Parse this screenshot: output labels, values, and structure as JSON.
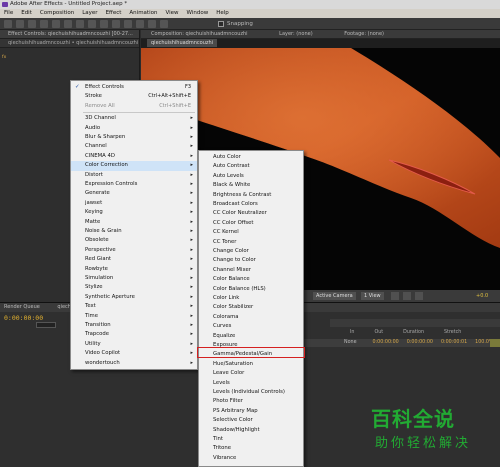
{
  "window": {
    "title": "Adobe After Effects - Untitled Project.aep *"
  },
  "menubar": [
    "File",
    "Edit",
    "Composition",
    "Layer",
    "Effect",
    "Animation",
    "View",
    "Window",
    "Help"
  ],
  "toolbar": {
    "snapping_label": "Snapping"
  },
  "left_panel": {
    "tab": "Effect Controls: qiechuishihuadmncouzhi [00-27...",
    "path": "qiechuishihuadmncouzhi • qiechuishihuadmncouzhi [00-271].png",
    "effect_item": "fx"
  },
  "composition": {
    "header_composition": "Composition: qiechuishihuadmncouzhi",
    "header_layer": "Layer: (none)",
    "header_footage": "Footage: (none)",
    "tab": "qiechuishihuadmncouzhi"
  },
  "viewer_controls": {
    "camera": "Active Camera",
    "view": "1 View",
    "value": "+0.0"
  },
  "timeline": {
    "tabs": [
      "Render Queue",
      "qiechuishi..."
    ],
    "timecode": "0:00:00:00",
    "columns": [
      "In",
      "Out",
      "Duration",
      "Stretch"
    ],
    "row": {
      "parent": "None",
      "in": "0:00:00:00",
      "out": "0:00:00:00",
      "duration": "0:00:00:01",
      "stretch": "100.0%"
    }
  },
  "context_menu": {
    "items": [
      {
        "label": "Effect Controls",
        "shortcut": "F3",
        "checked": true
      },
      {
        "label": "Stroke",
        "shortcut": "Ctrl+Alt+Shift+E"
      },
      {
        "label": "Remove All",
        "shortcut": "Ctrl+Shift+E",
        "disabled": true
      },
      {
        "label": "3D Channel",
        "submenu": true
      },
      {
        "label": "Audio",
        "submenu": true
      },
      {
        "label": "Blur & Sharpen",
        "submenu": true
      },
      {
        "label": "Channel",
        "submenu": true
      },
      {
        "label": "CINEMA 4D",
        "submenu": true
      },
      {
        "label": "Color Correction",
        "submenu": true,
        "highlighted": true
      },
      {
        "label": "Distort",
        "submenu": true
      },
      {
        "label": "Expression Controls",
        "submenu": true
      },
      {
        "label": "Generate",
        "submenu": true
      },
      {
        "label": "jawset",
        "submenu": true
      },
      {
        "label": "Keying",
        "submenu": true
      },
      {
        "label": "Matte",
        "submenu": true
      },
      {
        "label": "Noise & Grain",
        "submenu": true
      },
      {
        "label": "Obsolete",
        "submenu": true
      },
      {
        "label": "Perspective",
        "submenu": true
      },
      {
        "label": "Red Giant",
        "submenu": true
      },
      {
        "label": "Rowbyte",
        "submenu": true
      },
      {
        "label": "Simulation",
        "submenu": true
      },
      {
        "label": "Stylize",
        "submenu": true
      },
      {
        "label": "Synthetic Aperture",
        "submenu": true
      },
      {
        "label": "Text",
        "submenu": true
      },
      {
        "label": "Time",
        "submenu": true
      },
      {
        "label": "Transition",
        "submenu": true
      },
      {
        "label": "Trapcode",
        "submenu": true
      },
      {
        "label": "Utility",
        "submenu": true
      },
      {
        "label": "Video Copilot",
        "submenu": true
      },
      {
        "label": "wondertouch",
        "submenu": true
      }
    ]
  },
  "color_correction_menu": {
    "items": [
      "Auto Color",
      "Auto Contrast",
      "Auto Levels",
      "Black & White",
      "Brightness & Contrast",
      "Broadcast Colors",
      "CC Color Neutralizer",
      "CC Color Offset",
      "CC Kernel",
      "CC Toner",
      "Change Color",
      "Change to Color",
      "Channel Mixer",
      "Color Balance",
      "Color Balance (HLS)",
      "Color Link",
      "Color Stabilizer",
      "Colorama",
      "Curves",
      "Equalize",
      "Exposure",
      "Gamma/Pedestal/Gain",
      "Hue/Saturation",
      "Leave Color",
      "Levels",
      "Levels (Individual Controls)",
      "Photo Filter",
      "PS Arbitrary Map",
      "Selective Color",
      "Shadow/Highlight",
      "Tint",
      "Tritone",
      "Vibrance"
    ],
    "selected": "Gamma/Pedestal/Gain"
  },
  "watermark": {
    "title": "百科全说",
    "subtitle": "助你轻松解决"
  },
  "colors": {
    "accent_orange": "#c4531f",
    "highlight_red": "#d42020",
    "watermark_green": "#22aa33",
    "timecode": "#e0b030"
  }
}
